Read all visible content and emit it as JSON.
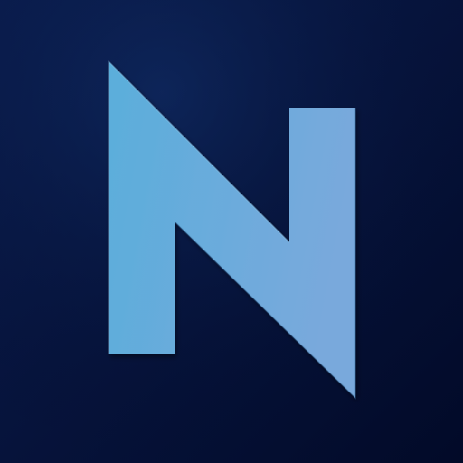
{
  "logo": {
    "letter": "N",
    "icon": "letter-n-logo-icon"
  },
  "colors": {
    "background_top_left": "#0a1c4e",
    "background_bottom_right": "#020a28",
    "glyph_light": "#5aaedb",
    "glyph_dark": "#79a9dc",
    "glyph_edge_highlight": "#9fd4f2",
    "glyph_edge_shadow": "#3b6f9c"
  }
}
